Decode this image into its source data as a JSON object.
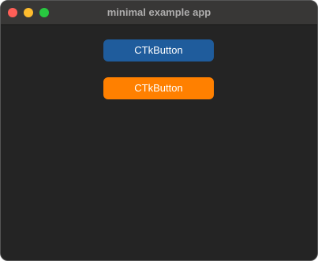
{
  "window": {
    "title": "minimal example app"
  },
  "buttons": [
    {
      "label": "CTkButton",
      "color": "#1f5c9c"
    },
    {
      "label": "CTkButton",
      "color": "#ff8000"
    }
  ],
  "theme": {
    "background": "#242424",
    "titlebar": "#383736",
    "close": "#ff5f57",
    "minimize": "#febc2e",
    "maximize": "#28c840"
  }
}
